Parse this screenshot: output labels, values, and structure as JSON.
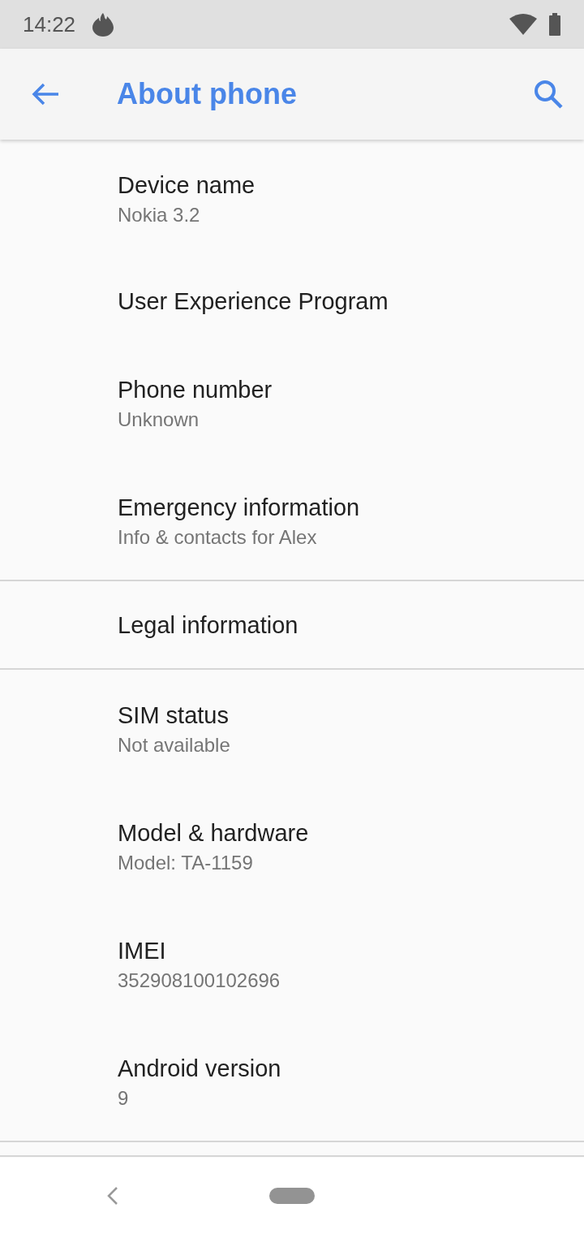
{
  "status_bar": {
    "time": "14:22"
  },
  "app_bar": {
    "title": "About phone"
  },
  "sections": [
    {
      "items": [
        {
          "title": "Device name",
          "subtitle": "Nokia 3.2"
        },
        {
          "title": "User Experience Program"
        },
        {
          "title": "Phone number",
          "subtitle": "Unknown"
        },
        {
          "title": "Emergency information",
          "subtitle": "Info & contacts for Alex"
        }
      ]
    },
    {
      "items": [
        {
          "title": "Legal information"
        }
      ]
    },
    {
      "items": [
        {
          "title": "SIM status",
          "subtitle": "Not available"
        },
        {
          "title": "Model & hardware",
          "subtitle": "Model: TA-1159"
        },
        {
          "title": "IMEI",
          "subtitle": "352908100102696"
        },
        {
          "title": "Android version",
          "subtitle": "9"
        }
      ]
    }
  ]
}
